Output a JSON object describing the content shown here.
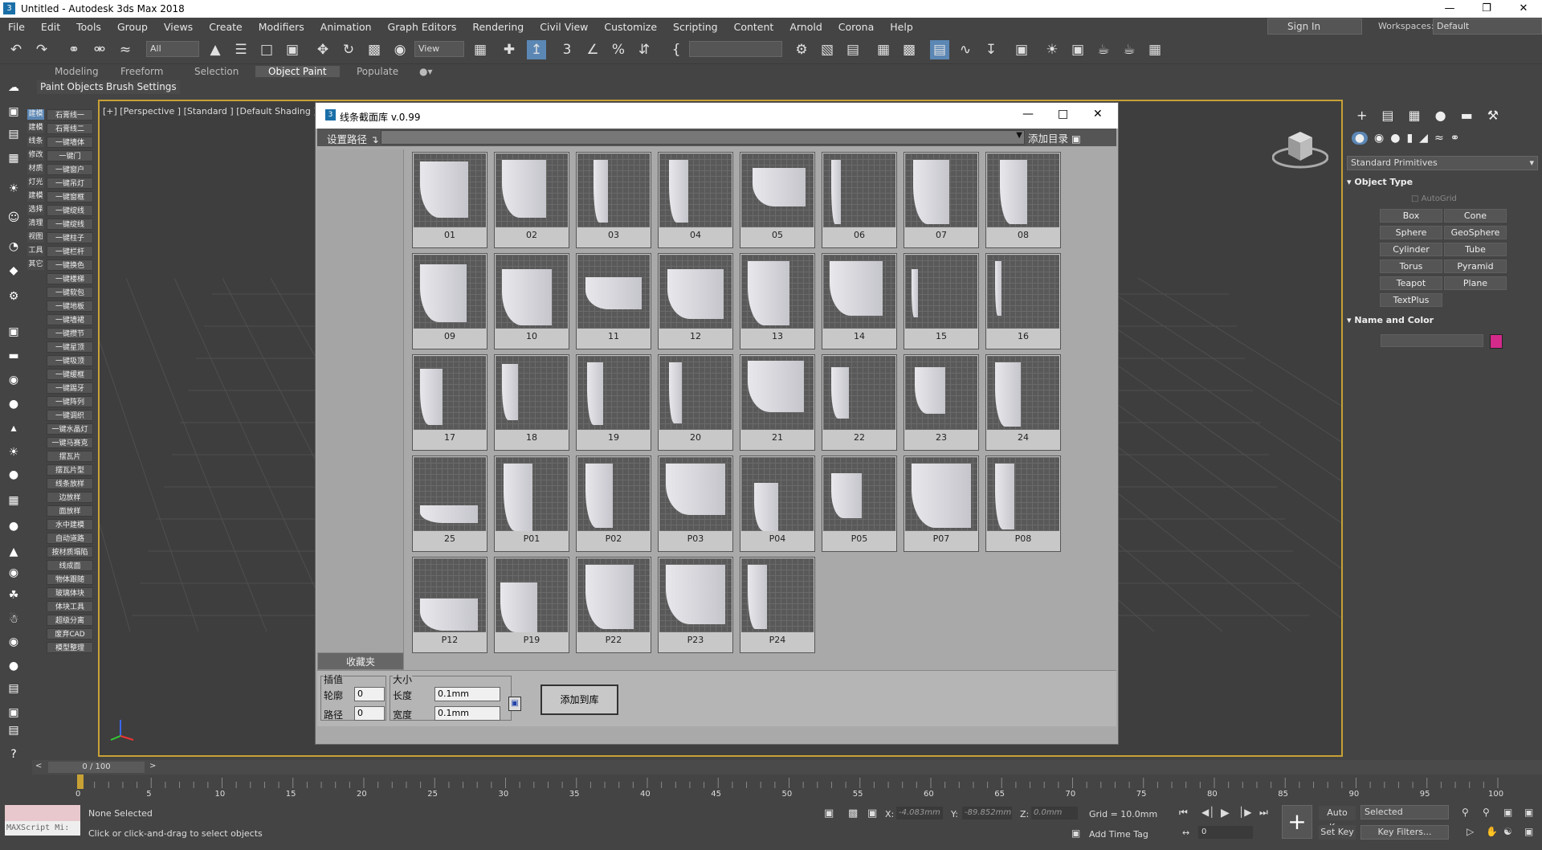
{
  "app": {
    "title": "Untitled - Autodesk 3ds Max 2018"
  },
  "menu": [
    "File",
    "Edit",
    "Tools",
    "Group",
    "Views",
    "Create",
    "Modifiers",
    "Animation",
    "Graph Editors",
    "Rendering",
    "Civil View",
    "Customize",
    "Scripting",
    "Content",
    "Arnold",
    "Corona",
    "Help"
  ],
  "signin": "Sign In",
  "workspaces": {
    "label": "Workspaces:",
    "value": "Default"
  },
  "toolbar": {
    "filter": "All",
    "refcoord": "View"
  },
  "ribbon": {
    "tabs": [
      "Modeling",
      "Freeform",
      "Selection",
      "Object Paint",
      "Populate"
    ],
    "buttons": [
      "Paint Objects",
      "Brush Settings"
    ]
  },
  "left_cn": [
    "建模",
    "材质",
    "灯光",
    "渲染",
    "选择",
    "清理",
    "视图",
    "工具",
    "其它"
  ],
  "left_tools": [
    "石膏线一",
    "石膏线二",
    "一键墙体",
    "一键门",
    "一键窗户",
    "一键吊灯",
    "一键窗框",
    "一键绽线",
    "一键绽线",
    "一键柱子",
    "一键栏杆",
    "一键换色",
    "一键楼梯",
    "一键软包",
    "一键地板",
    "一键墙裙",
    "一键攒节",
    "一键星顶",
    "一键吸顶",
    "一键缓框",
    "一键踢牙",
    "一键阵列",
    "一键调织",
    "一键水晶灯",
    "一键马赛克",
    "摆瓦片",
    "摆瓦片型",
    "线条放样",
    "边放样",
    "面放样",
    "水中建模",
    "自动道路",
    "按材质塌陷",
    "线成面",
    "物体跟随",
    "玻璃体块",
    "体块工具",
    "超级分离",
    "废弃CAD",
    "模型整理"
  ],
  "left_cn_col": [
    "建模",
    "建模",
    "线条",
    "修改",
    "材质",
    "灯光",
    "建模",
    "选择",
    "清理",
    "视图",
    "工具",
    "其它"
  ],
  "viewport": {
    "label": "[+] [Perspective ] [Standard ] [Default Shading ]"
  },
  "cmd": {
    "dropdown": "Standard Primitives",
    "rollout1": "Object Type",
    "autogrid": "AutoGrid",
    "buttons": [
      "Box",
      "Cone",
      "Sphere",
      "GeoSphere",
      "Cylinder",
      "Tube",
      "Torus",
      "Pyramid",
      "Teapot",
      "Plane",
      "TextPlus"
    ],
    "rollout2": "Name and Color",
    "color": "#d42a8a"
  },
  "dialog": {
    "title": "线条截面库 v.0.99",
    "setpath": "设置路径",
    "addcat": "添加目录",
    "fav": "收藏夹",
    "tiles": [
      "01",
      "02",
      "03",
      "04",
      "05",
      "06",
      "07",
      "08",
      "09",
      "10",
      "11",
      "12",
      "13",
      "14",
      "15",
      "16",
      "17",
      "18",
      "19",
      "20",
      "21",
      "22",
      "23",
      "24",
      "25",
      "P01",
      "P02",
      "P03",
      "P04",
      "P05",
      "P07",
      "P08",
      "P12",
      "P19",
      "P22",
      "P23",
      "P24"
    ],
    "interp": {
      "title": "插值",
      "contour": "轮廓",
      "contour_v": "0",
      "path": "路径",
      "path_v": "0"
    },
    "size": {
      "title": "大小",
      "len": "长度",
      "len_v": "0.1mm",
      "wid": "宽度",
      "wid_v": "0.1mm"
    },
    "addlib": "添加到库"
  },
  "timeline": {
    "value": "0 / 100",
    "ticks": [
      "0",
      "5",
      "10",
      "15",
      "20",
      "25",
      "30",
      "35",
      "40",
      "45",
      "50",
      "55",
      "60",
      "65",
      "70",
      "75",
      "80",
      "85",
      "90",
      "95",
      "100"
    ]
  },
  "status": {
    "maxscript": "MAXScript Mi:",
    "none": "None Selected",
    "hint": "Click or click-and-drag to select objects",
    "x_label": "X:",
    "x": "-4.083mm",
    "y_label": "Y:",
    "y": "-89.852mm",
    "z_label": "Z:",
    "z": "0.0mm",
    "grid": "Grid = 10.0mm",
    "addtime": "Add Time Tag",
    "autokey": "Auto Key",
    "setkey": "Set Key",
    "selected": "Selected",
    "keyfilters": "Key Filters...",
    "frame": "0"
  }
}
